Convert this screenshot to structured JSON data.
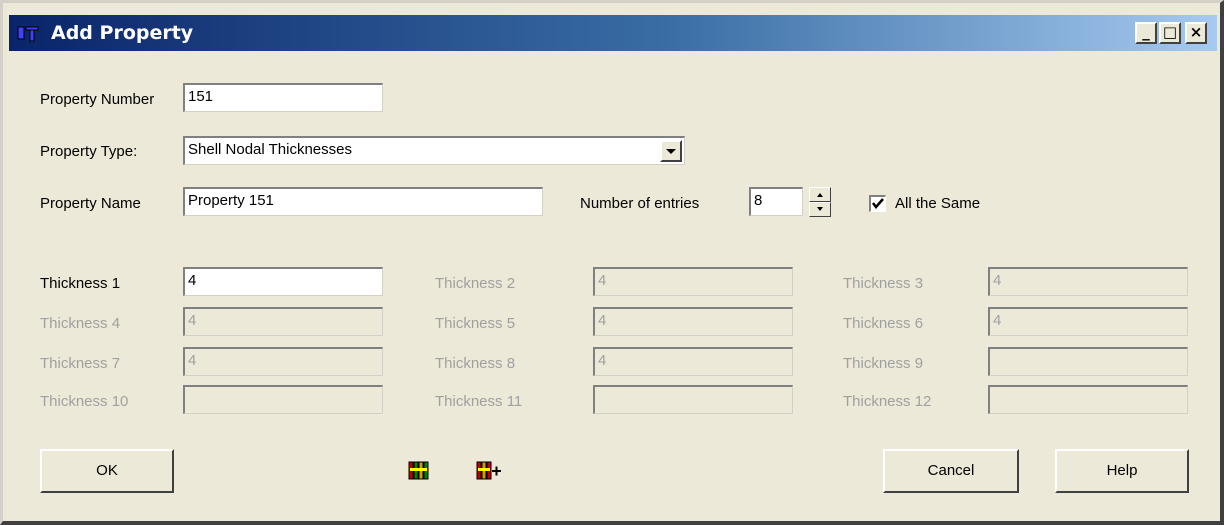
{
  "window": {
    "title": "Add Property"
  },
  "title_buttons": {
    "minimize": "_",
    "maximize": "□",
    "close": "×"
  },
  "property_number": {
    "label": "Property Number",
    "value": "151"
  },
  "property_type": {
    "label": "Property Type:",
    "value": "Shell Nodal Thicknesses"
  },
  "property_name": {
    "label": "Property Name",
    "value": "Property 151"
  },
  "entries": {
    "label": "Number of entries",
    "value": "8"
  },
  "all_same": {
    "label": "All the Same",
    "checked": true
  },
  "thickness": [
    {
      "label": "Thickness 1",
      "value": "4",
      "enabled": true
    },
    {
      "label": "Thickness 2",
      "value": "4",
      "enabled": false
    },
    {
      "label": "Thickness 3",
      "value": "4",
      "enabled": false
    },
    {
      "label": "Thickness 4",
      "value": "4",
      "enabled": false
    },
    {
      "label": "Thickness 5",
      "value": "4",
      "enabled": false
    },
    {
      "label": "Thickness 6",
      "value": "4",
      "enabled": false
    },
    {
      "label": "Thickness 7",
      "value": "4",
      "enabled": false
    },
    {
      "label": "Thickness 8",
      "value": "4",
      "enabled": false
    },
    {
      "label": "Thickness 9",
      "value": "",
      "enabled": false
    },
    {
      "label": "Thickness 10",
      "value": "",
      "enabled": false
    },
    {
      "label": "Thickness 11",
      "value": "",
      "enabled": false
    },
    {
      "label": "Thickness 12",
      "value": "",
      "enabled": false
    }
  ],
  "buttons": {
    "ok": "OK",
    "cancel": "Cancel",
    "help": "Help"
  },
  "icons": {
    "library": "library-icon",
    "library_add": "library-add-icon"
  },
  "colors": {
    "title_start": "#0a246a",
    "title_end": "#a6caf0",
    "face": "#ece9d8",
    "disabled_text": "#a0a0a0"
  }
}
